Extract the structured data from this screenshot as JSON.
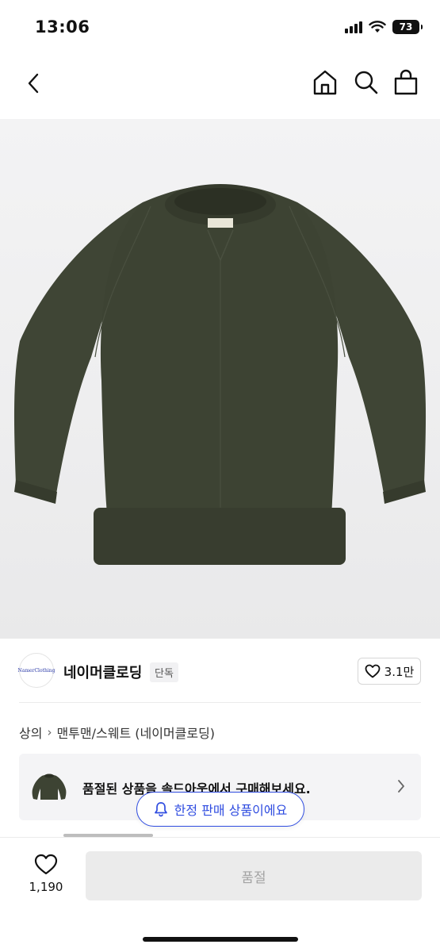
{
  "status_bar": {
    "time": "13:06",
    "battery": "73",
    "icons": [
      "signal-icon",
      "wifi-icon",
      "battery-icon"
    ]
  },
  "nav": {
    "icons": [
      "chevron-left-icon",
      "home-icon",
      "search-icon",
      "shopping-bag-icon"
    ]
  },
  "product_image": {
    "description_icon": "sweatshirt-image",
    "garment_color": "#3f4535"
  },
  "brand": {
    "logo_text": "NamerClothing",
    "name": "네이머클로딩",
    "badge": "단독",
    "like_count": "3.1만"
  },
  "breadcrumb": {
    "category": "상의",
    "subcategory": "맨투맨/스웨트 (네이머클로딩)"
  },
  "soldout_banner": {
    "text": "품절된 상품을 솔드아웃에서 구매해보세요."
  },
  "limited_pill": {
    "text": "한정 판매 상품이에요",
    "color": "#2f4ce0"
  },
  "action_bar": {
    "wish_count": "1,190",
    "buy_label": "품절"
  }
}
